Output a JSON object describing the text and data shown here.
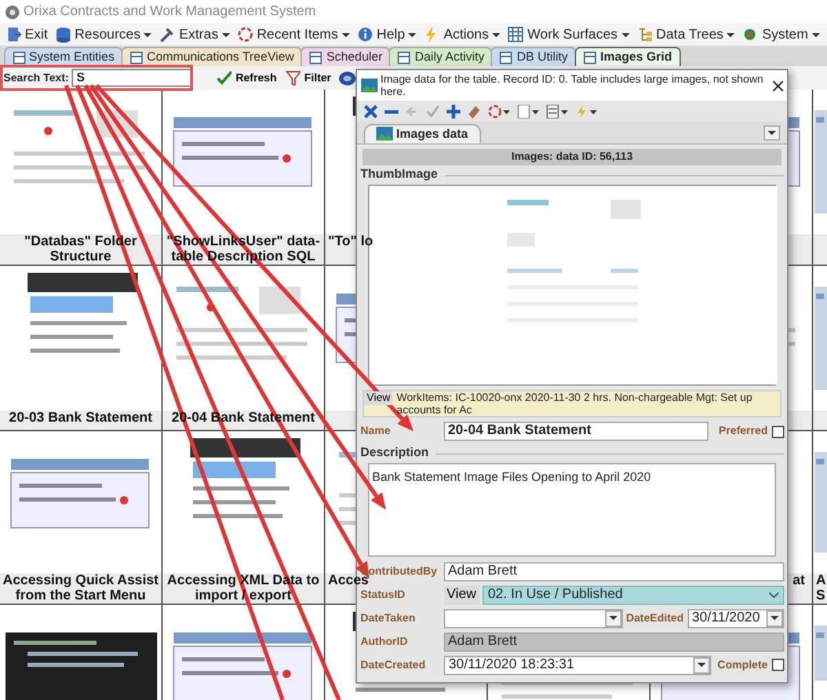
{
  "window": {
    "title": "Orixa Contracts and Work Management System"
  },
  "menu": [
    {
      "label": "Exit",
      "dropdown": false
    },
    {
      "label": "Resources",
      "dropdown": true
    },
    {
      "label": "Extras",
      "dropdown": true
    },
    {
      "label": "Recent Items",
      "dropdown": true
    },
    {
      "label": "Help",
      "dropdown": true
    },
    {
      "label": "Actions",
      "dropdown": true
    },
    {
      "label": "Work Surfaces",
      "dropdown": true
    },
    {
      "label": "Data Trees",
      "dropdown": true
    },
    {
      "label": "System",
      "dropdown": true
    }
  ],
  "tabs": [
    {
      "label": "System Entities",
      "selected": false,
      "color": "#cddbef"
    },
    {
      "label": "Communications TreeView",
      "selected": false,
      "color": "#f1e4c8"
    },
    {
      "label": "Scheduler",
      "selected": false,
      "color": "#efd6e6"
    },
    {
      "label": "Daily Activity",
      "selected": false,
      "color": "#d3ebc5"
    },
    {
      "label": "DB Utility",
      "selected": false,
      "color": "#c9dcee"
    },
    {
      "label": "Images Grid",
      "selected": true,
      "color": "#eef6e8"
    }
  ],
  "toolbar": {
    "search_label": "Search Text:",
    "search_value": "S",
    "buttons": [
      "Refresh",
      "Filter"
    ]
  },
  "grid": {
    "rows": [
      [
        {
          "caption": "\"Databas\" Folder Structure"
        },
        {
          "caption": "\"ShowLinksUser\" data-table Description SQL"
        },
        {
          "caption": "\"To\" lo"
        },
        {},
        {},
        {}
      ],
      [
        {
          "caption": "20-03 Bank Statement"
        },
        {
          "caption": "20-04 Bank Statement"
        },
        {},
        {},
        {},
        {}
      ],
      [
        {
          "caption": "Accessing Quick Assist from the Start Menu"
        },
        {
          "caption": "Accessing XML Data to import / export"
        },
        {
          "caption": "Acces"
        },
        {},
        {
          "caption": "at"
        },
        {
          "caption": "A S"
        }
      ],
      [
        {},
        {},
        {},
        {},
        {},
        {}
      ]
    ]
  },
  "dialog": {
    "title": "Image data for the  table. Record ID: 0. Table includes large images, not shown here.",
    "tab": {
      "label": "Images data",
      "selected": true
    },
    "header": "Images: data ID: 56,113",
    "thumb_label": "ThumbImage",
    "view_bar": {
      "button": "View",
      "text": "WorkItems: IC-10020-onx 2020-11-30 2 hrs. Non-chargeable Mgt: Set up accounts for Ac"
    },
    "name": {
      "label": "Name",
      "value": "20-04 Bank Statement"
    },
    "preferred": {
      "label": "Preferred",
      "checked": false
    },
    "description": {
      "label": "Description",
      "value": "Bank Statement Image Files Opening to April 2020"
    },
    "contributed_by": {
      "label": "ContributedBy",
      "value": "Adam Brett"
    },
    "status": {
      "label": "StatusID",
      "button": "View",
      "value": "02. In Use / Published"
    },
    "date_taken": {
      "label": "DateTaken"
    },
    "date_edited": {
      "label": "DateEdited",
      "value": "30/11/2020"
    },
    "author": {
      "label": "AuthorID",
      "value": "Adam Brett",
      "disabled": true
    },
    "date_created": {
      "label": "DateCreated",
      "value": "30/11/2020 18:23:31"
    },
    "complete": {
      "label": "Complete",
      "checked": false
    }
  }
}
